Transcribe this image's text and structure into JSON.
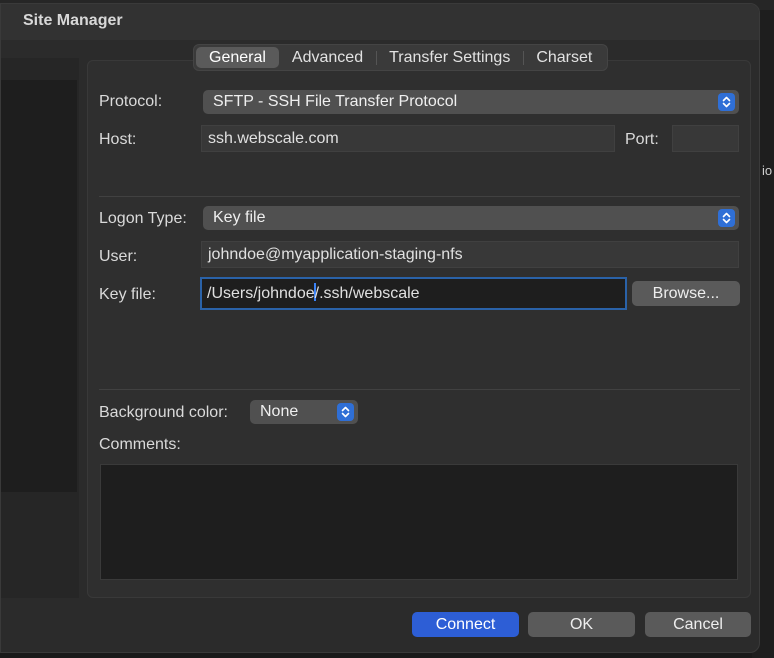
{
  "window": {
    "title": "Site Manager"
  },
  "background": {
    "right_edge_text": "io"
  },
  "tabs": [
    {
      "label": "General",
      "active": true
    },
    {
      "label": "Advanced",
      "active": false
    },
    {
      "label": "Transfer Settings",
      "active": false
    },
    {
      "label": "Charset",
      "active": false
    }
  ],
  "general": {
    "protocol_label": "Protocol:",
    "protocol_value": "SFTP - SSH File Transfer Protocol",
    "host_label": "Host:",
    "host_value": "ssh.webscale.com",
    "port_label": "Port:",
    "port_value": "",
    "logon_type_label": "Logon Type:",
    "logon_type_value": "Key file",
    "user_label": "User:",
    "user_value": "johndoe@myapplication-staging-nfs",
    "key_file_label": "Key file:",
    "key_file_value_before_caret": "/Users/johndoe",
    "key_file_value_after_caret": "/.ssh/webscale",
    "browse_label": "Browse...",
    "background_color_label": "Background color:",
    "background_color_value": "None",
    "comments_label": "Comments:",
    "comments_value": ""
  },
  "footer": {
    "connect_label": "Connect",
    "ok_label": "OK",
    "cancel_label": "Cancel"
  },
  "colors": {
    "accent": "#2d5ed6",
    "focus_ring": "#2a62a8",
    "stepper": "#2f6fd6"
  }
}
